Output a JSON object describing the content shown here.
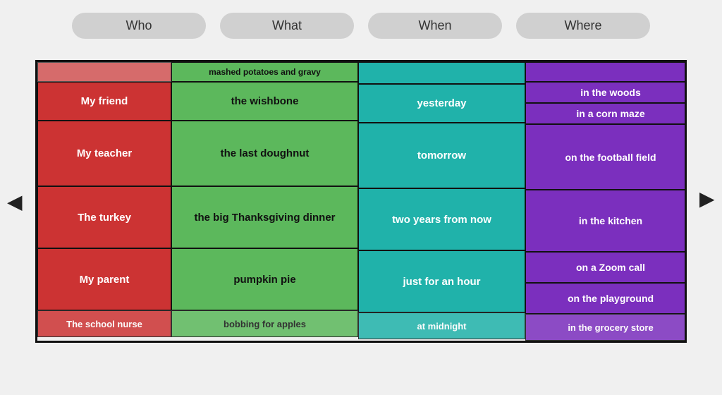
{
  "header": {
    "who_label": "Who",
    "what_label": "What",
    "when_label": "When",
    "where_label": "Where"
  },
  "arrows": {
    "left": "◀",
    "right": "◀"
  },
  "rows": [
    {
      "who": "",
      "what": "mashed potatoes and gravy",
      "when": "",
      "where": ""
    },
    {
      "who": "My friend",
      "what": "the wishbone",
      "when": "yesterday",
      "where_top": "in the woods",
      "where_bottom": "in a corn maze"
    },
    {
      "who": "My teacher",
      "what": "the last doughnut",
      "when": "tomorrow",
      "where_top": "on the football field",
      "where_bottom": ""
    },
    {
      "who": "The turkey",
      "what": "the big Thanksgiving dinner",
      "when": "two years from now",
      "where": "in the kitchen"
    },
    {
      "who": "My parent",
      "what": "pumpkin pie",
      "when": "just for an hour",
      "where_top": "on a Zoom call",
      "where_bottom": "on the playground"
    },
    {
      "who": "The school nurse",
      "what": "bobbing for apples",
      "when": "at midnight",
      "where_top": "in the grocery store",
      "where_bottom": ""
    }
  ]
}
